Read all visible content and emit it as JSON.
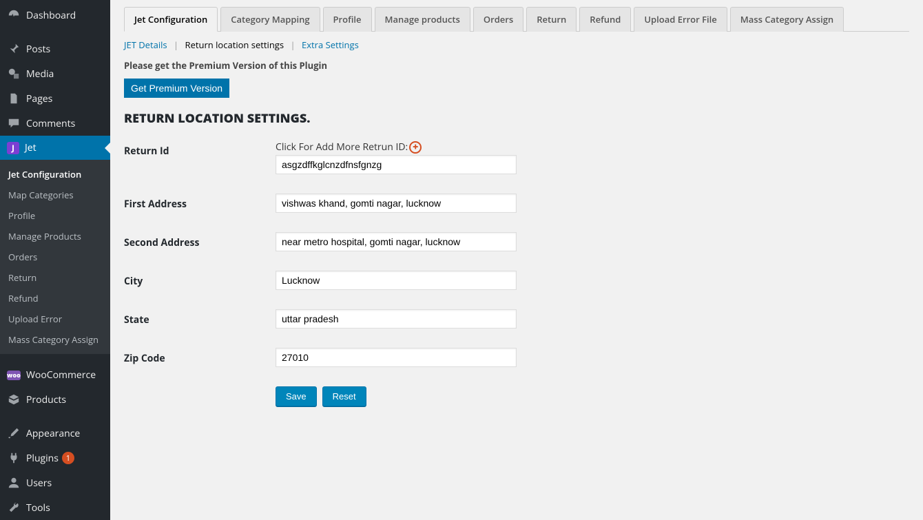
{
  "sidebar": {
    "items": [
      {
        "label": "Dashboard",
        "icon": "dashboard"
      },
      {
        "label": "Posts",
        "icon": "pin"
      },
      {
        "label": "Media",
        "icon": "media"
      },
      {
        "label": "Pages",
        "icon": "page"
      },
      {
        "label": "Comments",
        "icon": "comment"
      },
      {
        "label": "Jet",
        "icon": "jet",
        "active": true
      },
      {
        "label": "WooCommerce",
        "icon": "woo"
      },
      {
        "label": "Products",
        "icon": "products"
      },
      {
        "label": "Appearance",
        "icon": "brush"
      },
      {
        "label": "Plugins",
        "icon": "plug",
        "badge": "1"
      },
      {
        "label": "Users",
        "icon": "user"
      },
      {
        "label": "Tools",
        "icon": "wrench"
      }
    ],
    "jet_submenu": [
      "Jet Configuration",
      "Map Categories",
      "Profile",
      "Manage Products",
      "Orders",
      "Return",
      "Refund",
      "Upload Error",
      "Mass Category Assign"
    ]
  },
  "tabs": [
    "Jet Configuration",
    "Category Mapping",
    "Profile",
    "Manage products",
    "Orders",
    "Return",
    "Refund",
    "Upload Error File",
    "Mass Category Assign"
  ],
  "subnav": {
    "jet_details": "JET Details",
    "return_loc": "Return location settings",
    "extra": "Extra Settings"
  },
  "notice": "Please get the Premium Version of this Plugin",
  "premium_btn": "Get Premium Version",
  "section_title": "RETURN LOCATION SETTINGS.",
  "form": {
    "return_id": {
      "label": "Return Id",
      "hint": "Click For Add More Retrun ID:",
      "value": "asgzdffkglcnzdfnsfgnzg"
    },
    "first_address": {
      "label": "First Address",
      "value": "vishwas khand, gomti nagar, lucknow"
    },
    "second_address": {
      "label": "Second Address",
      "value": "near metro hospital, gomti nagar, lucknow"
    },
    "city": {
      "label": "City",
      "value": "Lucknow"
    },
    "state": {
      "label": "State",
      "value": "uttar pradesh"
    },
    "zip": {
      "label": "Zip Code",
      "value": "27010"
    }
  },
  "buttons": {
    "save": "Save",
    "reset": "Reset"
  }
}
